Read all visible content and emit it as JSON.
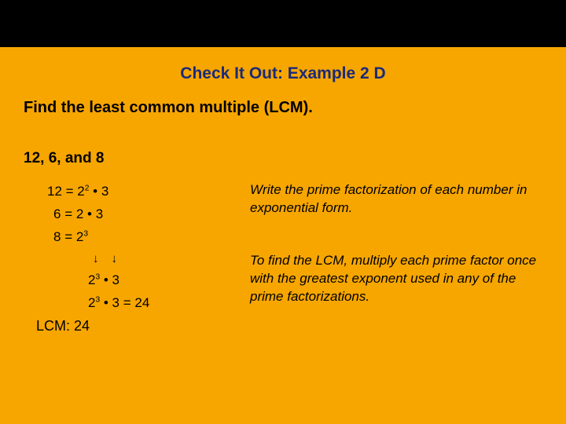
{
  "title": "Check It Out: Example 2 D",
  "prompt": "Find the least common multiple (LCM).",
  "subprompt": "12, 6, and 8",
  "factorizations": {
    "eq1": {
      "num": "12",
      "base": "2",
      "exp": "2",
      "tail": " • 3"
    },
    "eq2": {
      "num": "6",
      "base": "2",
      "exp": "",
      "tail": " • 3"
    },
    "eq3": {
      "num": "8",
      "base": "2",
      "exp": "3",
      "tail": ""
    }
  },
  "combine": {
    "base1": "2",
    "exp1": "3",
    "sep1": " • 3",
    "base2": "2",
    "exp2": "3",
    "sep2": " • 3 = 24"
  },
  "answer": "LCM: 24",
  "explain1": "Write the prime factorization of each number in exponential form.",
  "explain2": "To find the LCM, multiply each prime factor once with the greatest exponent used in any of the prime factorizations.",
  "glyphs": {
    "arrow": "↓"
  },
  "chart_data": {
    "type": "table",
    "title": "Prime factorizations and LCM",
    "rows": [
      {
        "n": 12,
        "factorization": "2^2 · 3"
      },
      {
        "n": 6,
        "factorization": "2 · 3"
      },
      {
        "n": 8,
        "factorization": "2^3"
      }
    ],
    "lcm_expression": "2^3 · 3",
    "lcm_value": 24
  }
}
